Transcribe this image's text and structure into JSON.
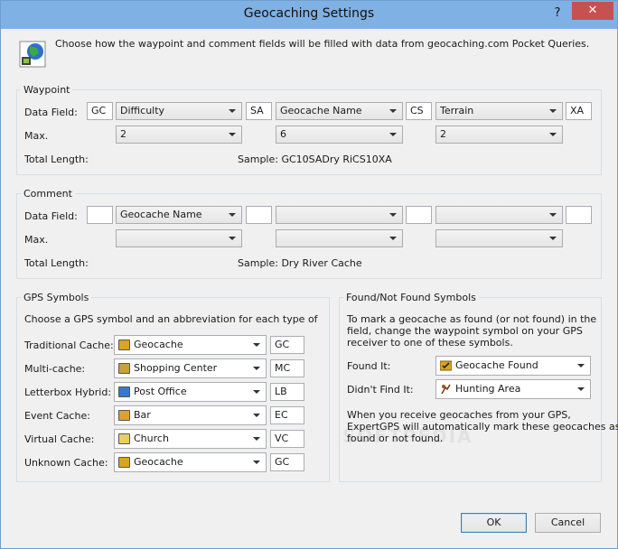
{
  "window": {
    "title": "Geocaching Settings",
    "help_label": "?",
    "close_label": "✕"
  },
  "intro": "Choose how the waypoint and comment fields will be filled with data from geocaching.com Pocket Queries.",
  "waypoint": {
    "title": "Waypoint",
    "data_field_label": "Data Field:",
    "max_label": "Max.",
    "total_length_label": "Total Length:",
    "sample": "Sample: GC10SADry RiCS10XA",
    "prefixes": [
      "GC",
      "SA",
      "CS",
      "XA"
    ],
    "fields": [
      "Difficulty",
      "Geocache Name",
      "Terrain"
    ],
    "max_values": [
      "2",
      "6",
      "2"
    ]
  },
  "comment": {
    "title": "Comment",
    "data_field_label": "Data Field:",
    "max_label": "Max.",
    "total_length_label": "Total Length:",
    "sample": "Sample: Dry River Cache",
    "prefixes": [
      "",
      "",
      "",
      ""
    ],
    "fields": [
      "Geocache Name",
      "",
      ""
    ],
    "max_values": [
      "",
      "",
      ""
    ]
  },
  "gps_symbols": {
    "title": "GPS Symbols",
    "description": "Choose a GPS symbol and an abbreviation for each type of",
    "rows": [
      {
        "label": "Traditional Cache:",
        "symbol": "Geocache",
        "abbr": "GC",
        "icon": "geocache-icon",
        "color": "#d9a520"
      },
      {
        "label": "Multi-cache:",
        "symbol": "Shopping Center",
        "abbr": "MC",
        "icon": "shopping-center-icon",
        "color": "#c8a03c"
      },
      {
        "label": "Letterbox Hybrid:",
        "symbol": "Post Office",
        "abbr": "LB",
        "icon": "post-office-icon",
        "color": "#3c78c8"
      },
      {
        "label": "Event Cache:",
        "symbol": "Bar",
        "abbr": "EC",
        "icon": "bar-icon",
        "color": "#e0a030"
      },
      {
        "label": "Virtual Cache:",
        "symbol": "Church",
        "abbr": "VC",
        "icon": "church-icon",
        "color": "#e8d060"
      },
      {
        "label": "Unknown Cache:",
        "symbol": "Geocache",
        "abbr": "GC",
        "icon": "geocache-icon",
        "color": "#d9a520"
      }
    ]
  },
  "found_symbols": {
    "title": "Found/Not Found Symbols",
    "description_lines": [
      "To mark a geocache as found (or not found) in the",
      "field, change the waypoint symbol on your GPS",
      "receiver to one of these symbols."
    ],
    "found_label": "Found It:",
    "found_value": "Geocache Found",
    "not_found_label": "Didn't Find It:",
    "not_found_value": "Hunting Area",
    "note_lines": [
      "When you receive geocaches from your GPS,",
      "ExpertGPS will automatically mark these geocaches as",
      "found or not found."
    ]
  },
  "buttons": {
    "ok": "OK",
    "cancel": "Cancel"
  },
  "watermark": "SOFTPEDIA"
}
